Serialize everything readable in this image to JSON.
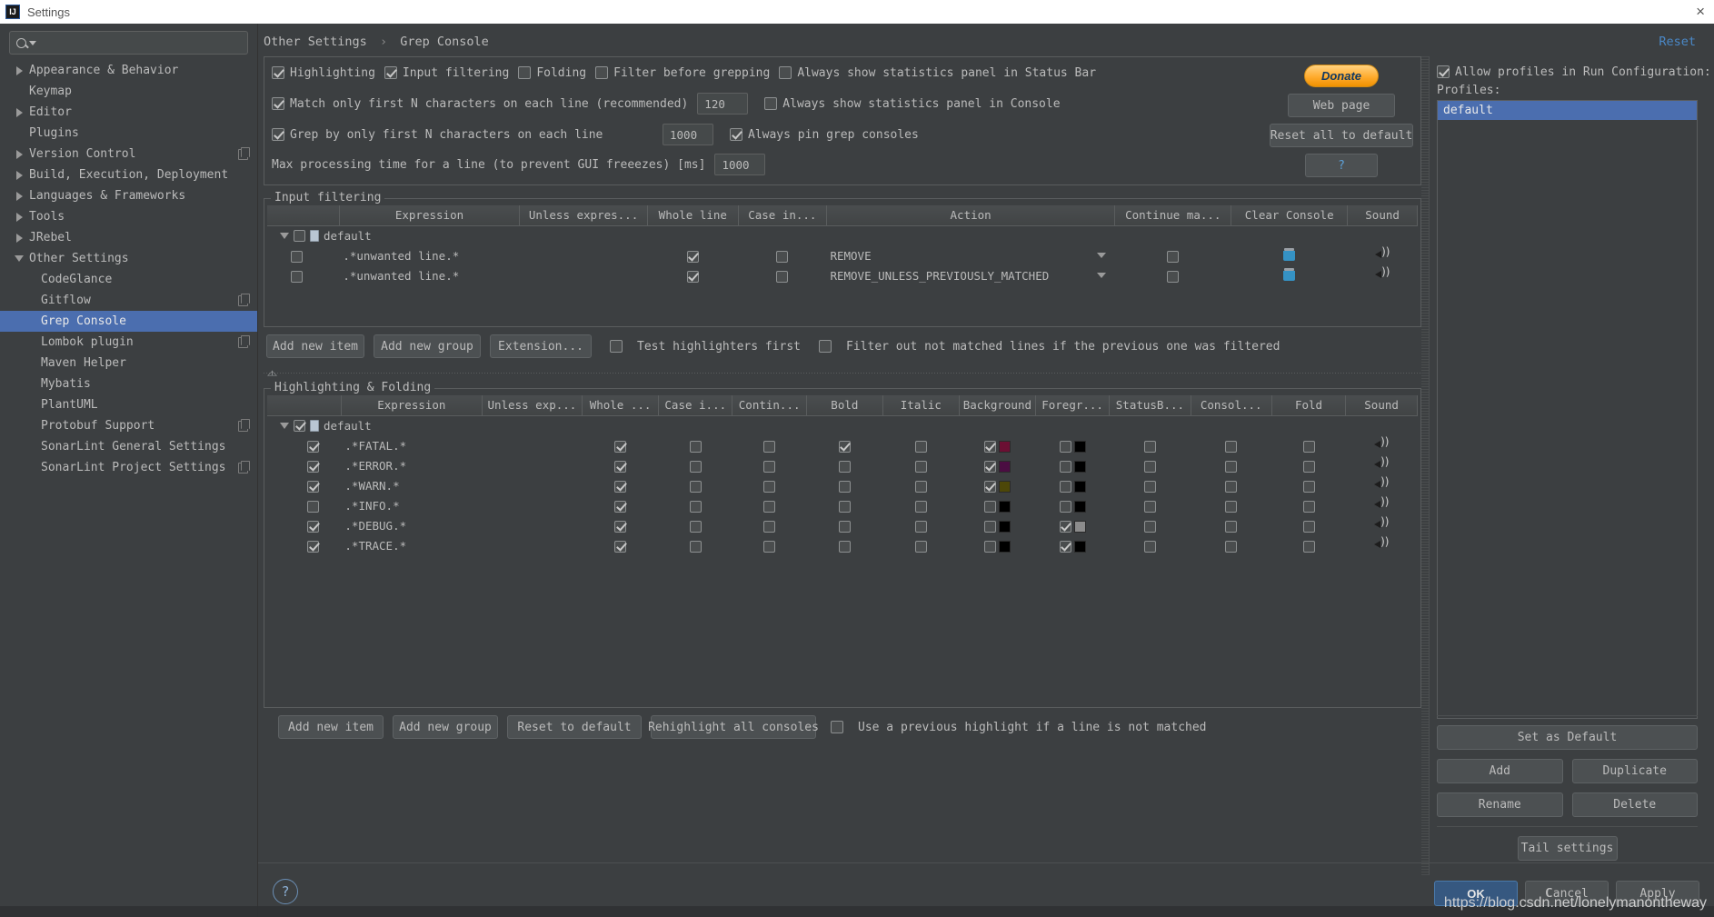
{
  "window": {
    "title": "Settings",
    "app_badge": "IJ",
    "close_icon": "×"
  },
  "search": {
    "placeholder": ""
  },
  "sidebar": {
    "items": [
      {
        "label": "Appearance & Behavior",
        "expandable": true,
        "expanded": false,
        "child": false,
        "badge": false
      },
      {
        "label": "Keymap",
        "expandable": false,
        "expanded": false,
        "child": false,
        "badge": false
      },
      {
        "label": "Editor",
        "expandable": true,
        "expanded": false,
        "child": false,
        "badge": false
      },
      {
        "label": "Plugins",
        "expandable": false,
        "expanded": false,
        "child": false,
        "badge": false
      },
      {
        "label": "Version Control",
        "expandable": true,
        "expanded": false,
        "child": false,
        "badge": true
      },
      {
        "label": "Build, Execution, Deployment",
        "expandable": true,
        "expanded": false,
        "child": false,
        "badge": false
      },
      {
        "label": "Languages & Frameworks",
        "expandable": true,
        "expanded": false,
        "child": false,
        "badge": false
      },
      {
        "label": "Tools",
        "expandable": true,
        "expanded": false,
        "child": false,
        "badge": false
      },
      {
        "label": "JRebel",
        "expandable": true,
        "expanded": false,
        "child": false,
        "badge": false
      },
      {
        "label": "Other Settings",
        "expandable": true,
        "expanded": true,
        "child": false,
        "badge": false
      },
      {
        "label": "CodeGlance",
        "expandable": false,
        "expanded": false,
        "child": true,
        "badge": false
      },
      {
        "label": "Gitflow",
        "expandable": false,
        "expanded": false,
        "child": true,
        "badge": true
      },
      {
        "label": "Grep Console",
        "expandable": false,
        "expanded": false,
        "child": true,
        "badge": false,
        "selected": true
      },
      {
        "label": "Lombok plugin",
        "expandable": false,
        "expanded": false,
        "child": true,
        "badge": true
      },
      {
        "label": "Maven Helper",
        "expandable": false,
        "expanded": false,
        "child": true,
        "badge": false
      },
      {
        "label": "Mybatis",
        "expandable": false,
        "expanded": false,
        "child": true,
        "badge": false
      },
      {
        "label": "PlantUML",
        "expandable": false,
        "expanded": false,
        "child": true,
        "badge": false
      },
      {
        "label": "Protobuf Support",
        "expandable": false,
        "expanded": false,
        "child": true,
        "badge": true
      },
      {
        "label": "SonarLint General Settings",
        "expandable": false,
        "expanded": false,
        "child": true,
        "badge": false
      },
      {
        "label": "SonarLint Project Settings",
        "expandable": false,
        "expanded": false,
        "child": true,
        "badge": true
      }
    ]
  },
  "breadcrumb": {
    "parent": "Other Settings",
    "separator": "›",
    "current": "Grep Console"
  },
  "reset_link": "Reset",
  "options": {
    "row1": [
      {
        "label": "Highlighting",
        "checked": true
      },
      {
        "label": "Input filtering",
        "checked": true
      },
      {
        "label": "Folding",
        "checked": false
      },
      {
        "label": "Filter before grepping",
        "checked": false
      },
      {
        "label": "Always show statistics panel in Status Bar",
        "checked": false
      }
    ],
    "row2": {
      "label": "Match only first N characters on each line (recommended)",
      "checked": true,
      "value": "120",
      "right_label": "Always show statistics panel in Console",
      "right_checked": false
    },
    "row3": {
      "label": "Grep by only first N characters on each line",
      "checked": true,
      "value": "1000",
      "right_label": "Always pin grep consoles",
      "right_checked": true
    },
    "row4": {
      "label": "Max processing time for a line (to prevent GUI freeezes) [ms]",
      "value": "1000"
    },
    "buttons": {
      "donate": "Donate",
      "web_page": "Web page",
      "reset_all": "Reset all to default",
      "help": "?"
    }
  },
  "input_filtering": {
    "title": "Input filtering",
    "columns": [
      "",
      "Expression",
      "Unless expres...",
      "Whole line",
      "Case in...",
      "Action",
      "Continue ma...",
      "Clear Console",
      "Sound"
    ],
    "group": {
      "label": "default",
      "checked": false,
      "expanded": true
    },
    "rows": [
      {
        "enabled": false,
        "expression": ".*unwanted line.*",
        "unless_expression": "",
        "whole_line": true,
        "case_insensitive": false,
        "action": "REMOVE",
        "continue_matching": false,
        "clear_console": "trash-icon",
        "sound": "speaker-icon"
      },
      {
        "enabled": false,
        "expression": ".*unwanted line.*",
        "unless_expression": "",
        "whole_line": true,
        "case_insensitive": false,
        "action": "REMOVE_UNLESS_PREVIOUSLY_MATCHED",
        "continue_matching": false,
        "clear_console": "trash-icon",
        "sound": "speaker-icon"
      }
    ],
    "toolbar": {
      "add_new_item": "Add new item",
      "add_new_group": "Add new group",
      "extension": "Extension...",
      "test_highlighters": {
        "label": "Test highlighters first",
        "checked": false
      },
      "filter_out": {
        "label": "Filter out not matched lines if the previous one was filtered",
        "checked": false
      }
    }
  },
  "highlighting": {
    "title": "Highlighting & Folding",
    "columns": [
      "",
      "Expression",
      "Unless exp...",
      "Whole ...",
      "Case i...",
      "Contin...",
      "Bold",
      "Italic",
      "Background",
      "Foregr...",
      "StatusB...",
      "Consol...",
      "Fold",
      "Sound"
    ],
    "group": {
      "label": "default",
      "checked": true,
      "expanded": true
    },
    "rows": [
      {
        "enabled": true,
        "expression": ".*FATAL.*",
        "whole_line": true,
        "case_insensitive": false,
        "continue_matching": false,
        "bold": true,
        "italic": false,
        "background_on": true,
        "background_color": "#6b0f33",
        "foreground_on": false,
        "foreground_color": "#000000",
        "status_bar": false,
        "console": false,
        "fold": false,
        "sound": "speaker-icon"
      },
      {
        "enabled": true,
        "expression": ".*ERROR.*",
        "whole_line": true,
        "case_insensitive": false,
        "continue_matching": false,
        "bold": false,
        "italic": false,
        "background_on": true,
        "background_color": "#4b0d42",
        "foreground_on": false,
        "foreground_color": "#000000",
        "status_bar": false,
        "console": false,
        "fold": false,
        "sound": "speaker-icon"
      },
      {
        "enabled": true,
        "expression": ".*WARN.*",
        "whole_line": true,
        "case_insensitive": false,
        "continue_matching": false,
        "bold": false,
        "italic": false,
        "background_on": true,
        "background_color": "#4d4708",
        "foreground_on": false,
        "foreground_color": "#000000",
        "status_bar": false,
        "console": false,
        "fold": false,
        "sound": "speaker-icon"
      },
      {
        "enabled": false,
        "expression": ".*INFO.*",
        "whole_line": true,
        "case_insensitive": false,
        "continue_matching": false,
        "bold": false,
        "italic": false,
        "background_on": false,
        "background_color": "#000000",
        "foreground_on": false,
        "foreground_color": "#000000",
        "status_bar": false,
        "console": false,
        "fold": false,
        "sound": "speaker-icon"
      },
      {
        "enabled": true,
        "expression": ".*DEBUG.*",
        "whole_line": true,
        "case_insensitive": false,
        "continue_matching": false,
        "bold": false,
        "italic": false,
        "background_on": false,
        "background_color": "#000000",
        "foreground_on": true,
        "foreground_color": "#8c8c8c",
        "status_bar": false,
        "console": false,
        "fold": false,
        "sound": "speaker-icon"
      },
      {
        "enabled": true,
        "expression": ".*TRACE.*",
        "whole_line": true,
        "case_insensitive": false,
        "continue_matching": false,
        "bold": false,
        "italic": false,
        "background_on": false,
        "background_color": "#000000",
        "foreground_on": true,
        "foreground_color": "#000000",
        "status_bar": false,
        "console": false,
        "fold": false,
        "sound": "speaker-icon"
      }
    ],
    "toolbar": {
      "add_new_item": "Add new item",
      "add_new_group": "Add new group",
      "reset_to_default": "Reset to default",
      "rehighlight": "Rehighlight all consoles",
      "use_previous": {
        "label": "Use a previous highlight if a line is not matched",
        "checked": false
      }
    }
  },
  "profiles_panel": {
    "allow_profiles": {
      "label": "Allow profiles in Run Configuration:",
      "checked": true
    },
    "profiles_label": "Profiles:",
    "profiles": [
      {
        "name": "default",
        "selected": true
      }
    ],
    "buttons": {
      "set_as_default": "Set as Default",
      "add": "Add",
      "duplicate": "Duplicate",
      "rename": "Rename",
      "delete": "Delete",
      "tail_settings": "Tail settings"
    }
  },
  "dialog": {
    "help_icon": "?",
    "ok": "OK",
    "cancel": "Cancel",
    "apply": "Apply"
  },
  "watermark": "https://blog.csdn.net/lonelymanontheway",
  "colors": {
    "accent_selection": "#4b6eaf",
    "ok_button": "#365880",
    "link": "#4a88c7",
    "donate_orange": "#ffab2e"
  }
}
